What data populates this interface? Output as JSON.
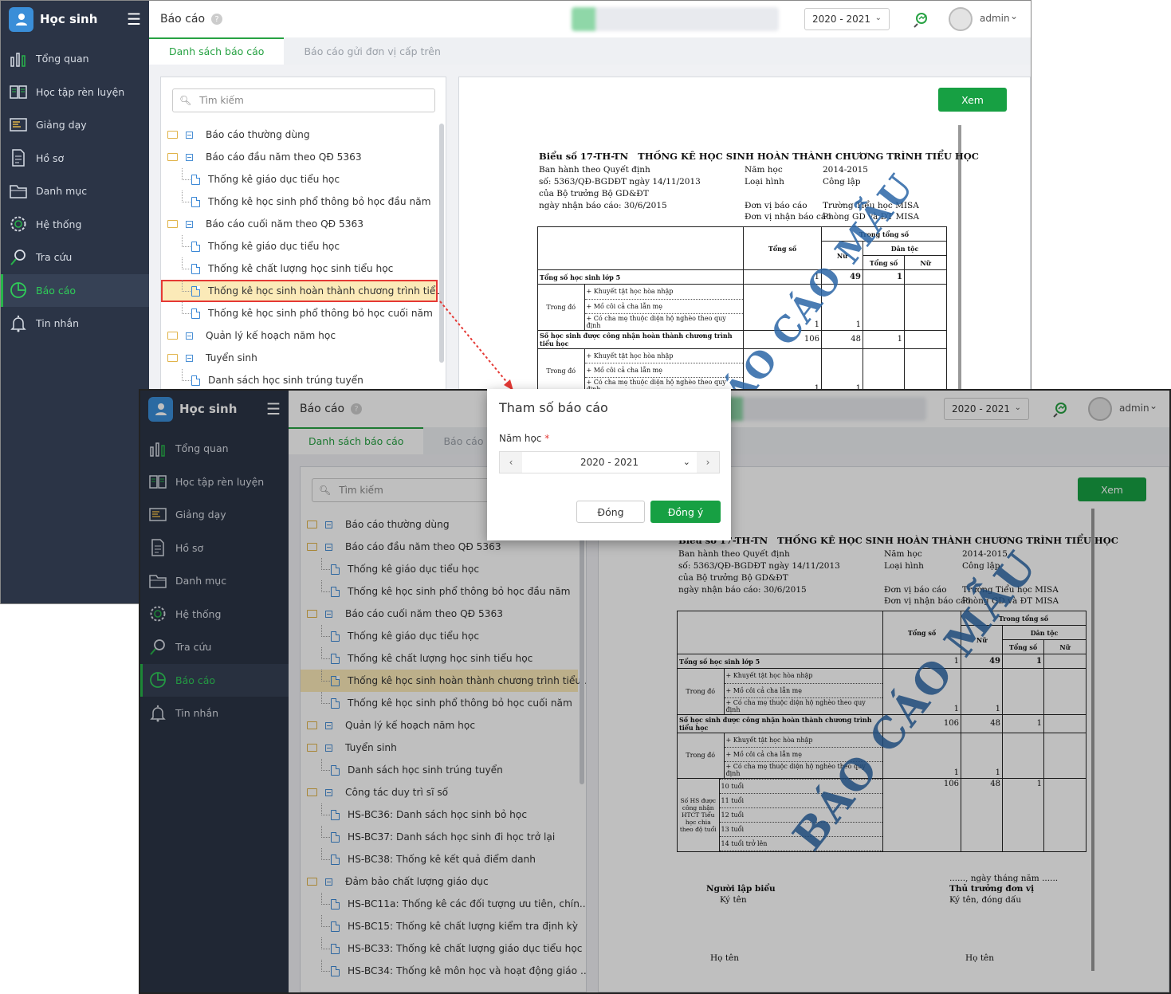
{
  "app": {
    "name": "Học sinh"
  },
  "nav": [
    {
      "label": "Tổng quan",
      "icon": "bar-chart-icon"
    },
    {
      "label": "Học tập rèn luyện",
      "icon": "book-icon"
    },
    {
      "label": "Giảng dạy",
      "icon": "board-icon"
    },
    {
      "label": "Hồ sơ",
      "icon": "file-icon"
    },
    {
      "label": "Danh mục",
      "icon": "folder-icon"
    },
    {
      "label": "Hệ thống",
      "icon": "gear-icon"
    },
    {
      "label": "Tra cứu",
      "icon": "search-icon"
    },
    {
      "label": "Báo cáo",
      "icon": "pie-chart-icon"
    },
    {
      "label": "Tin nhắn",
      "icon": "bell-icon"
    }
  ],
  "header": {
    "title": "Báo cáo",
    "help": "?",
    "year": "2020 - 2021",
    "user": "admin"
  },
  "tabs": [
    "Danh sách báo cáo",
    "Báo cáo gửi đơn vị cấp trên"
  ],
  "search": {
    "placeholder": "Tìm kiếm"
  },
  "tree": [
    "Báo cáo thường dùng",
    "Báo cáo đầu năm theo QĐ 5363",
    "Thống kê giáo dục tiểu học",
    "Thống kê học sinh phổ thông bỏ học đầu năm",
    "Báo cáo cuối năm theo QĐ 5363",
    "Thống kê giáo dục tiểu học",
    "Thống kê chất lượng học sinh tiểu học",
    "Thống kê học sinh hoàn thành chương trình tiểu...",
    "Thống kê học sinh phổ thông bỏ học cuối năm",
    "Quản lý kế hoạch năm học",
    "Tuyển sinh",
    "Danh sách học sinh trúng tuyển",
    "Công tác duy trì sĩ số",
    "HS-BC36: Danh sách học sinh bỏ học",
    "HS-BC37: Danh sách học sinh đi học trở lại",
    "HS-BC38: Thống kê kết quả điểm danh",
    "Đảm bảo chất lượng giáo dục",
    "HS-BC11a: Thống kê các đối tượng ưu tiên, chín...",
    "HS-BC15: Thống kê chất lượng kiểm tra định kỳ",
    "HS-BC33: Thống kê chất lượng giáo dục tiểu học",
    "HS-BC34: Thống kê môn học và hoạt động giáo ..."
  ],
  "view_button": "Xem",
  "report": {
    "code": "Biểu số 17-TH-TN",
    "title": "THỐNG KÊ HỌC SINH HOÀN THÀNH CHƯƠNG TRÌNH TIỂU HỌC",
    "left_lines": [
      "Ban hành theo Quyết định",
      "số: 5363/QĐ-BGDĐT ngày 14/11/2013",
      "của Bộ trưởng Bộ GD&ĐT",
      "ngày nhận báo cáo: 30/6/2015"
    ],
    "nam_hoc_label": "Năm học",
    "nam_hoc": "2014-2015",
    "loai_hinh_label": "Loại hình",
    "loai_hinh": "Công lập",
    "don_vi_bc_label": "Đơn vị báo cáo",
    "don_vi_bc": "Trường Tiểu học MISA",
    "don_vi_nhan_label": "Đơn vị nhận báo cáo",
    "don_vi_nhan": "Phòng GD và ĐT MISA",
    "h_trong_tong_so": "Trong tổng số",
    "h_tong_so": "Tổng số",
    "h_dan_toc": "Dân tộc",
    "h_nu": "Nữ",
    "r_tong_hs": "Tổng số học sinh lớp 5",
    "r_trong_do": "Trong đó",
    "r_kt": "+ Khuyết tật học hòa nhập",
    "r_mc": "+ Mồ côi cả cha lẫn mẹ",
    "r_hn": "+ Có cha mẹ thuộc diện hộ nghèo theo quy định",
    "r_htct": "Số học sinh được công nhận hoàn thành chương trình tiểu học",
    "r_age_group": "Số HS được công nhận HTCT Tiểu học chia theo độ tuổi",
    "ages": [
      "10 tuổi",
      "11 tuổi",
      "12 tuổi",
      "13 tuổi",
      "14 tuổi trở lên"
    ],
    "v_tong_1": "1",
    "v_nu_1": "49",
    "v_dt_1": "1",
    "v_hn_t": "1",
    "v_hn_n": "1",
    "v_ht_t": "106",
    "v_ht_n": "48",
    "v_ht_d": "1",
    "v_hn2_t": "1",
    "v_hn2_n": "1",
    "v_10_t": "106",
    "v_10_n": "48",
    "v_10_d": "1",
    "date_line": "......, ngày    tháng      năm ......",
    "nguoi_lap": "Người lập biểu",
    "thu_truong": "Thủ trưởng đơn vị",
    "ky_ten": "Ký tên",
    "ky_ten_dau": "Ký tên, đóng dấu",
    "ho_ten": "Họ tên",
    "watermark": "BÁO CÁO MẪU"
  },
  "dialog": {
    "title": "Tham số báo cáo",
    "label": "Năm học",
    "required": "*",
    "value": "2020 - 2021",
    "close": "Đóng",
    "ok": "Đồng ý"
  },
  "colors": {
    "sidebar": "#2b3446",
    "accent": "#17a043",
    "active_text": "#2fcb58",
    "selected_row": "#fbeab8",
    "highlight": "#e53935"
  }
}
